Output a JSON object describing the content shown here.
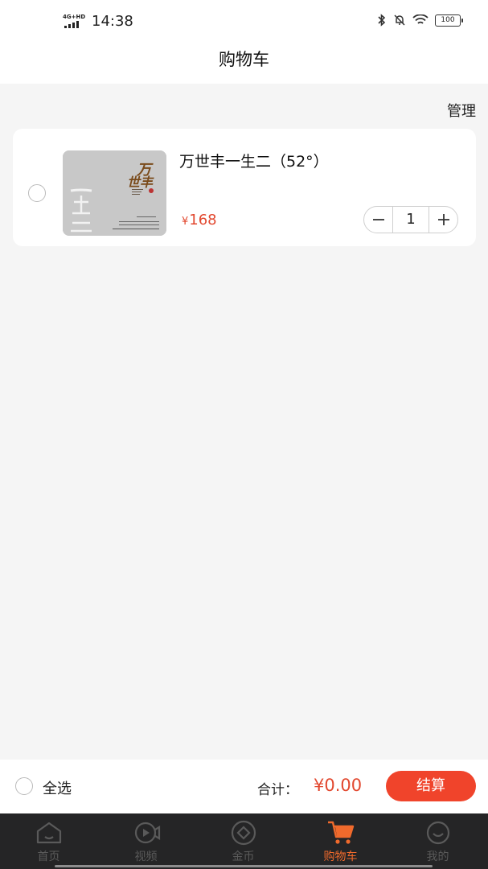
{
  "status_bar": {
    "network": "4G+HD",
    "time": "14:38",
    "battery": "100"
  },
  "header": {
    "title": "购物车"
  },
  "manage_label": "管理",
  "cart_items": [
    {
      "name": "万世丰一生二（52°）",
      "price_symbol": "¥",
      "price": "168",
      "quantity": "1",
      "image_label": "万世丰一生二"
    }
  ],
  "checkout": {
    "select_all_label": "全选",
    "total_label": "合计：",
    "total_value": "¥0.00",
    "checkout_label": "结算"
  },
  "tabs": [
    {
      "label": "首页",
      "icon": "home-icon",
      "active": false
    },
    {
      "label": "视频",
      "icon": "video-icon",
      "active": false
    },
    {
      "label": "金币",
      "icon": "coin-icon",
      "active": false
    },
    {
      "label": "购物车",
      "icon": "cart-icon",
      "active": true
    },
    {
      "label": "我的",
      "icon": "profile-icon",
      "active": false
    }
  ],
  "colors": {
    "accent": "#f0442b",
    "price": "#e2482f",
    "active_tab": "#f06a2c",
    "tab_bar": "#252526"
  }
}
